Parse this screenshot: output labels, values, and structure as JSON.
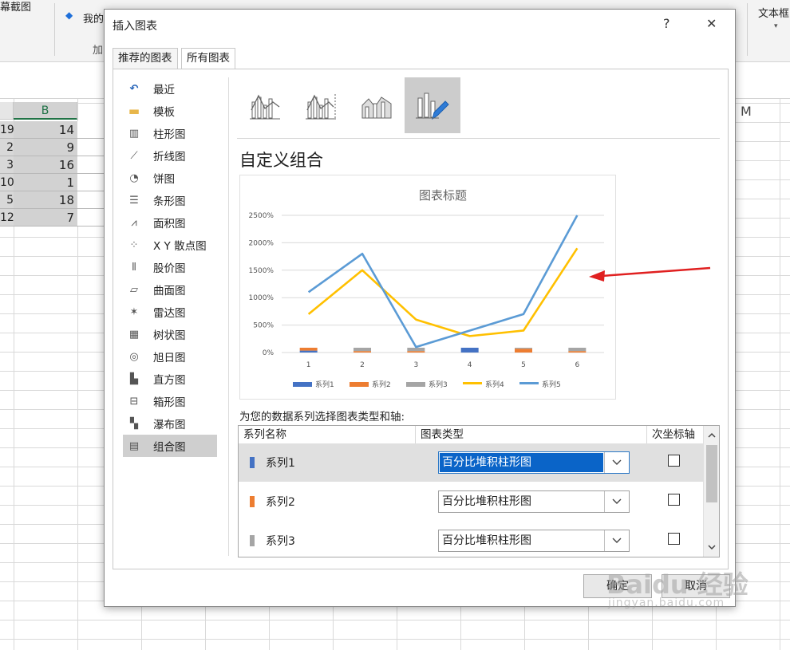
{
  "ribbon": {
    "screenshot_label": "幕截图",
    "my_addins": "我的",
    "addins_group": "加",
    "text_box": "文本框"
  },
  "sheet": {
    "col_b": "B",
    "col_m": "M",
    "col_a_values": [
      "19",
      "2",
      "3",
      "10",
      "5",
      "12"
    ],
    "col_b_values": [
      "14",
      "9",
      "16",
      "1",
      "18",
      "7"
    ]
  },
  "dialog": {
    "title": "插入图表",
    "help": "?",
    "close": "✕",
    "tabs": [
      "推荐的图表",
      "所有图表"
    ],
    "sidebar": [
      {
        "label": "最近",
        "icon": "recent-icon"
      },
      {
        "label": "模板",
        "icon": "folder-icon"
      },
      {
        "label": "柱形图",
        "icon": "column-chart-icon"
      },
      {
        "label": "折线图",
        "icon": "line-chart-icon"
      },
      {
        "label": "饼图",
        "icon": "pie-chart-icon"
      },
      {
        "label": "条形图",
        "icon": "bar-chart-icon"
      },
      {
        "label": "面积图",
        "icon": "area-chart-icon"
      },
      {
        "label": "X Y 散点图",
        "icon": "scatter-chart-icon"
      },
      {
        "label": "股价图",
        "icon": "stock-chart-icon"
      },
      {
        "label": "曲面图",
        "icon": "surface-chart-icon"
      },
      {
        "label": "雷达图",
        "icon": "radar-chart-icon"
      },
      {
        "label": "树状图",
        "icon": "treemap-chart-icon"
      },
      {
        "label": "旭日图",
        "icon": "sunburst-chart-icon"
      },
      {
        "label": "直方图",
        "icon": "histogram-chart-icon"
      },
      {
        "label": "箱形图",
        "icon": "box-chart-icon"
      },
      {
        "label": "瀑布图",
        "icon": "waterfall-chart-icon"
      },
      {
        "label": "组合图",
        "icon": "combo-chart-icon"
      }
    ],
    "heading": "自定义组合",
    "series_prompt": "为您的数据系列选择图表类型和轴:",
    "table": {
      "headers": [
        "系列名称",
        "图表类型",
        "次坐标轴"
      ],
      "rows": [
        {
          "name": "系列1",
          "type": "百分比堆积柱形图",
          "color": "#4472c4"
        },
        {
          "name": "系列2",
          "type": "百分比堆积柱形图",
          "color": "#ed7d31"
        },
        {
          "name": "系列3",
          "type": "百分比堆积柱形图",
          "color": "#a5a5a5"
        }
      ]
    },
    "ok": "确定",
    "cancel": "取消"
  },
  "watermark": {
    "brand": "Baidu 经验",
    "url": "jingyan.baidu.com"
  },
  "colors": {
    "series1": "#4472c4",
    "series2": "#ed7d31",
    "series3": "#a5a5a5",
    "series4": "#ffc000",
    "series5": "#5b9bd5",
    "arrow": "#e02020"
  },
  "chart_data": {
    "type": "line",
    "title": "图表标题",
    "x": [
      "1",
      "2",
      "3",
      "4",
      "5",
      "6"
    ],
    "y_ticks": [
      "0%",
      "500%",
      "1000%",
      "1500%",
      "2000%",
      "2500%"
    ],
    "ylim": [
      0,
      2500
    ],
    "grid": true,
    "legend_placement": "bottom",
    "series": [
      {
        "name": "系列1",
        "kind": "bar",
        "values": [
          40,
          0,
          0,
          100,
          0,
          0
        ]
      },
      {
        "name": "系列2",
        "kind": "bar",
        "values": [
          60,
          30,
          30,
          0,
          80,
          30
        ]
      },
      {
        "name": "系列3",
        "kind": "bar",
        "values": [
          0,
          70,
          70,
          0,
          20,
          70
        ]
      },
      {
        "name": "系列4",
        "kind": "line",
        "values": [
          700,
          1500,
          600,
          300,
          400,
          1900
        ]
      },
      {
        "name": "系列5",
        "kind": "line",
        "values": [
          1100,
          1800,
          100,
          400,
          700,
          2500
        ]
      }
    ]
  }
}
